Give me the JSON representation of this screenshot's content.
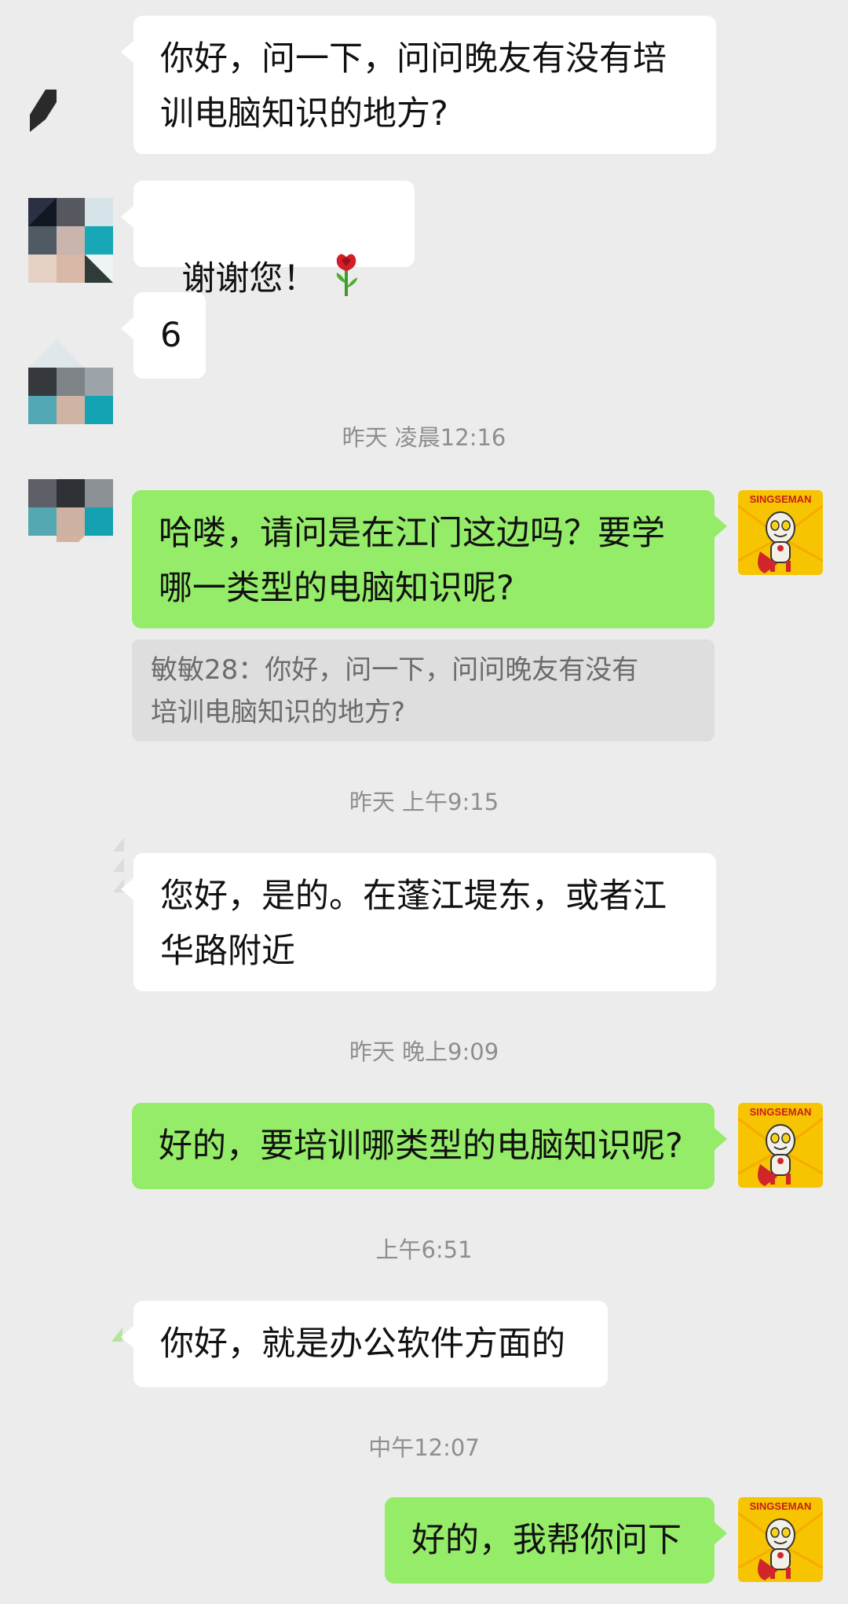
{
  "messages": [
    {
      "side": "in",
      "text": "你好，问一下，问问晚友有没有培\n训电脑知识的地方?"
    },
    {
      "side": "in",
      "text": "谢谢您！",
      "emoji": [
        "rose-emoji",
        "rose-emoji"
      ]
    },
    {
      "side": "in",
      "text": "6"
    },
    {
      "side": "out",
      "text": "哈喽，请问是在江门这边吗？要学\n哪一类型的电脑知识呢?"
    },
    {
      "side": "in",
      "text": "您好，是的。在蓬江堤东，或者江\n华路附近"
    },
    {
      "side": "out",
      "text": "好的，要培训哪类型的电脑知识呢?"
    },
    {
      "side": "in",
      "text": "你好，就是办公软件方面的"
    },
    {
      "side": "out",
      "text": "好的，我帮你问下"
    }
  ],
  "quote": {
    "text": "敏敏28：你好，问一下，问问晚友有没有\n培训电脑知识的地方?"
  },
  "timestamps": [
    "昨天 凌晨12:16",
    "昨天 上午9:15",
    "昨天 晚上9:09",
    "上午6:51",
    "中午12:07"
  ],
  "my_avatar": {
    "label": "SINGSEMAN",
    "icon": "cartoon-hero-avatar"
  },
  "colors": {
    "background": "#ececec",
    "incoming": "#ffffff",
    "outgoing": "#95ec69",
    "timestamp": "#8e8e8e"
  }
}
